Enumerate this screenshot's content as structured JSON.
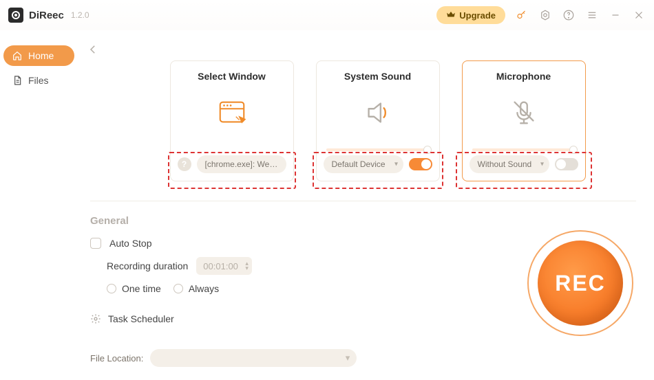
{
  "app": {
    "name": "DiReec",
    "version": "1.2.0"
  },
  "titlebar": {
    "upgrade": "Upgrade"
  },
  "sidebar": {
    "items": [
      {
        "label": "Home"
      },
      {
        "label": "Files"
      }
    ]
  },
  "cards": {
    "window": {
      "title": "Select Window",
      "selected": "[chrome.exe]: We…"
    },
    "system": {
      "title": "System Sound",
      "device": "Default Device",
      "enabled": true
    },
    "mic": {
      "title": "Microphone",
      "device": "Without Sound",
      "enabled": false
    }
  },
  "general": {
    "heading": "General",
    "autostop_label": "Auto Stop",
    "duration_label": "Recording duration",
    "duration_value": "00:01:00",
    "onetime": "One time",
    "always": "Always",
    "task_scheduler": "Task Scheduler",
    "file_location_label": "File Location:",
    "file_location_value": ""
  },
  "rec": {
    "label": "REC"
  }
}
